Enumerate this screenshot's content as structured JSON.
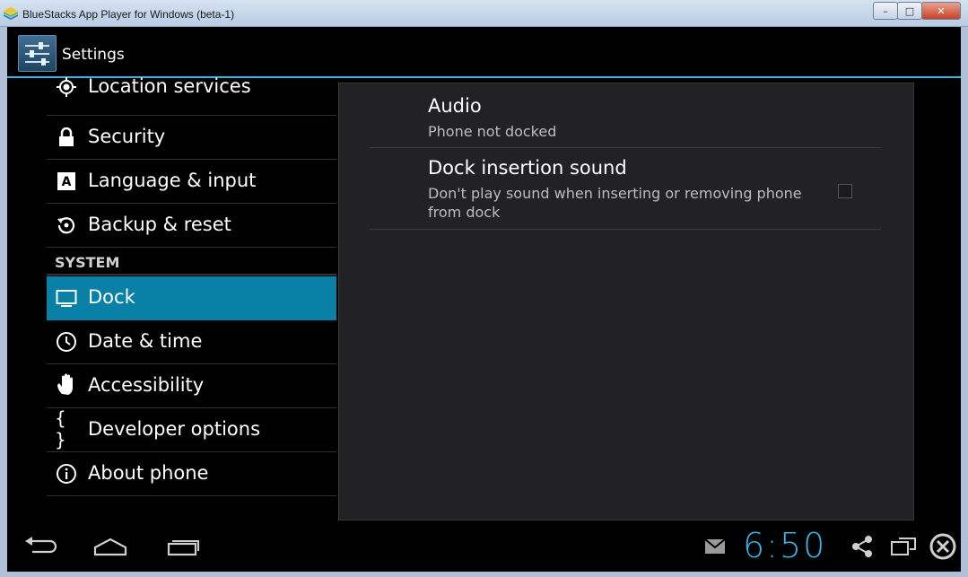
{
  "window": {
    "title": "BlueStacks App Player for Windows (beta-1)",
    "minimize": "–",
    "maximize": "□",
    "close": "✕"
  },
  "actionbar": {
    "title": "Settings",
    "icon": "settings-sliders-icon"
  },
  "sidebar": {
    "items_top": [
      {
        "label": "Location services",
        "icon": "location-icon"
      },
      {
        "label": "Security",
        "icon": "lock-icon"
      },
      {
        "label": "Language & input",
        "icon": "keyboard-icon"
      },
      {
        "label": "Backup & reset",
        "icon": "backup-icon"
      }
    ],
    "section_header": "SYSTEM",
    "items_system": [
      {
        "label": "Dock",
        "icon": "monitor-icon",
        "selected": true
      },
      {
        "label": "Date & time",
        "icon": "clock-icon"
      },
      {
        "label": "Accessibility",
        "icon": "hand-icon"
      },
      {
        "label": "Developer options",
        "icon": "braces-icon",
        "glyph": "{ }"
      },
      {
        "label": "About phone",
        "icon": "info-icon"
      }
    ]
  },
  "pane": {
    "prefs": [
      {
        "title": "Audio",
        "summary": "Phone not docked"
      },
      {
        "title": "Dock insertion sound",
        "summary": "Don't play sound when inserting or removing phone from dock",
        "checked": false
      }
    ]
  },
  "navbar": {
    "clock": "6:50",
    "icons": [
      "back-icon",
      "home-icon",
      "recents-icon",
      "gmail-icon",
      "share-icon",
      "screen-rotate-icon",
      "close-circle-icon"
    ]
  },
  "colors": {
    "accent": "#33b5e5",
    "selected": "#0980a6",
    "pane_bg": "#222225"
  }
}
